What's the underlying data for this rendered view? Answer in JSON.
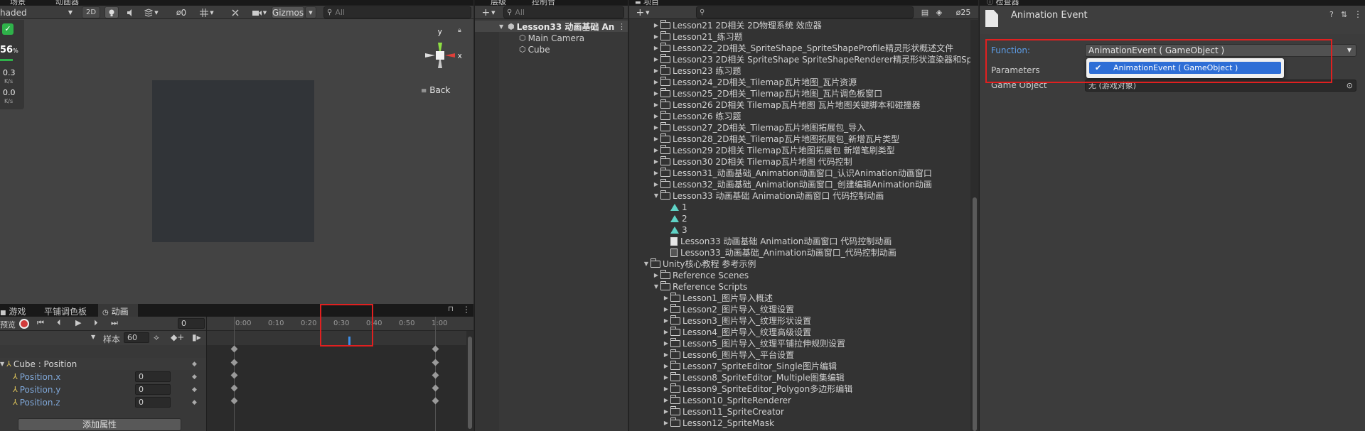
{
  "scene": {
    "tabs": [
      "场景",
      "动画器"
    ],
    "shading": "haded",
    "mode_2d": "2D",
    "hidden_count": "0",
    "gizmos": "Gizmos",
    "search_placeholder": "All",
    "stats": {
      "percent": "56",
      "percent_unit": "%",
      "v1": "0.3",
      "v1_unit": "K/s",
      "v2": "0.0",
      "v2_unit": "K/s"
    },
    "axis_y": "y",
    "axis_x": "x",
    "back": "Back"
  },
  "anim": {
    "tabs": [
      "游戏",
      "平铺调色板",
      "动画"
    ],
    "preview": "预览",
    "frame": "0",
    "ticks": [
      "0:00",
      "0:10",
      "0:20",
      "0:30",
      "0:40",
      "0:50",
      "1:00"
    ],
    "sample_label": "样本",
    "sample_value": "60",
    "tracks": [
      {
        "label": "Cube : Position",
        "value": ""
      },
      {
        "label": "Position.x",
        "value": "0"
      },
      {
        "label": "Position.y",
        "value": "0"
      },
      {
        "label": "Position.z",
        "value": "0"
      }
    ],
    "add_property": "添加属性"
  },
  "hierarchy": {
    "tabs": [
      "层级",
      "控制台"
    ],
    "search_placeholder": "All",
    "scene_name": "Lesson33 动画基础 An",
    "children": [
      "Main Camera",
      "Cube"
    ]
  },
  "project": {
    "tab": "项目",
    "hidden_count": "25",
    "items": [
      {
        "label": "Lesson21 2D相关 2D物理系统 效应器",
        "indent": 1,
        "kind": "folder",
        "expand": "closed"
      },
      {
        "label": "Lesson21_练习题",
        "indent": 1,
        "kind": "folder",
        "expand": "closed"
      },
      {
        "label": "Lesson22_2D相关_SpriteShape_SpriteShapeProfile精灵形状概述文件",
        "indent": 1,
        "kind": "folder",
        "expand": "closed"
      },
      {
        "label": "Lesson23 2D相关 SpriteShape SpriteShapeRenderer精灵形状渲染器和Sp",
        "indent": 1,
        "kind": "folder",
        "expand": "closed"
      },
      {
        "label": "Lesson23 练习题",
        "indent": 1,
        "kind": "folder",
        "expand": "closed"
      },
      {
        "label": "Lesson24_2D相关_Tilemap瓦片地图_瓦片资源",
        "indent": 1,
        "kind": "folder",
        "expand": "closed"
      },
      {
        "label": "Lesson25_2D相关_Tilemap瓦片地图_瓦片调色板窗口",
        "indent": 1,
        "kind": "folder",
        "expand": "closed"
      },
      {
        "label": "Lesson26 2D相关 Tilemap瓦片地图 瓦片地图关键脚本和碰撞器",
        "indent": 1,
        "kind": "folder",
        "expand": "closed"
      },
      {
        "label": "Lesson26 练习题",
        "indent": 1,
        "kind": "folder",
        "expand": "closed"
      },
      {
        "label": "Lesson27_2D相关_Tilemap瓦片地图拓展包_导入",
        "indent": 1,
        "kind": "folder",
        "expand": "closed"
      },
      {
        "label": "Lesson28_2D相关_Tilemap瓦片地图拓展包_新增瓦片类型",
        "indent": 1,
        "kind": "folder",
        "expand": "closed"
      },
      {
        "label": "Lesson29 2D相关 Tilemap瓦片地图拓展包 新增笔刷类型",
        "indent": 1,
        "kind": "folder",
        "expand": "closed"
      },
      {
        "label": "Lesson30 2D相关 Tilemap瓦片地图 代码控制",
        "indent": 1,
        "kind": "folder",
        "expand": "closed"
      },
      {
        "label": "Lesson31_动画基础_Animation动画窗口_认识Animation动画窗口",
        "indent": 1,
        "kind": "folder",
        "expand": "closed"
      },
      {
        "label": "Lesson32_动画基础_Animation动画窗口_创建编辑Animation动画",
        "indent": 1,
        "kind": "folder",
        "expand": "closed"
      },
      {
        "label": "Lesson33 动画基础 Animation动画窗口 代码控制动画",
        "indent": 1,
        "kind": "folder-open",
        "expand": "open"
      },
      {
        "label": "1",
        "indent": 2,
        "kind": "anim",
        "expand": "none"
      },
      {
        "label": "2",
        "indent": 2,
        "kind": "anim",
        "expand": "none"
      },
      {
        "label": "3",
        "indent": 2,
        "kind": "anim",
        "expand": "none"
      },
      {
        "label": "Lesson33 动画基础 Animation动画窗口 代码控制动画",
        "indent": 2,
        "kind": "file",
        "expand": "none"
      },
      {
        "label": "Lesson33_动画基础_Animation动画窗口_代码控制动画",
        "indent": 2,
        "kind": "script",
        "expand": "none"
      },
      {
        "label": "Unity核心教程 参考示例",
        "indent": 0,
        "kind": "folder-open",
        "expand": "open"
      },
      {
        "label": "Reference Scenes",
        "indent": 1,
        "kind": "folder",
        "expand": "closed"
      },
      {
        "label": "Reference Scripts",
        "indent": 1,
        "kind": "folder-open",
        "expand": "open"
      },
      {
        "label": "Lesson1_图片导入概述",
        "indent": 2,
        "kind": "folder",
        "expand": "closed"
      },
      {
        "label": "Lesson2_图片导入_纹理设置",
        "indent": 2,
        "kind": "folder",
        "expand": "closed"
      },
      {
        "label": "Lesson3_图片导入_纹理形状设置",
        "indent": 2,
        "kind": "folder",
        "expand": "closed"
      },
      {
        "label": "Lesson4_图片导入_纹理高级设置",
        "indent": 2,
        "kind": "folder",
        "expand": "closed"
      },
      {
        "label": "Lesson5_图片导入_纹理平铺拉伸规则设置",
        "indent": 2,
        "kind": "folder",
        "expand": "closed"
      },
      {
        "label": "Lesson6_图片导入_平台设置",
        "indent": 2,
        "kind": "folder",
        "expand": "closed"
      },
      {
        "label": "Lesson7_SpriteEditor_Single图片编辑",
        "indent": 2,
        "kind": "folder",
        "expand": "closed"
      },
      {
        "label": "Lesson8_SpriteEditor_Multiple图集编辑",
        "indent": 2,
        "kind": "folder",
        "expand": "closed"
      },
      {
        "label": "Lesson9_SpriteEditor_Polygon多边形编辑",
        "indent": 2,
        "kind": "folder",
        "expand": "closed"
      },
      {
        "label": "Lesson10_SpriteRenderer",
        "indent": 2,
        "kind": "folder",
        "expand": "closed"
      },
      {
        "label": "Lesson11_SpriteCreator",
        "indent": 2,
        "kind": "folder",
        "expand": "closed"
      },
      {
        "label": "Lesson12_SpriteMask",
        "indent": 2,
        "kind": "folder",
        "expand": "closed"
      }
    ]
  },
  "inspector": {
    "tab": "检查器",
    "title": "Animation Event",
    "function_label": "Function:",
    "function_value": "AnimationEvent ( GameObject )",
    "parameters_label": "Parameters",
    "dropdown_option": "AnimationEvent ( GameObject )",
    "gameobject_label": "Game Object",
    "gameobject_value": "无 (游戏对象)"
  }
}
